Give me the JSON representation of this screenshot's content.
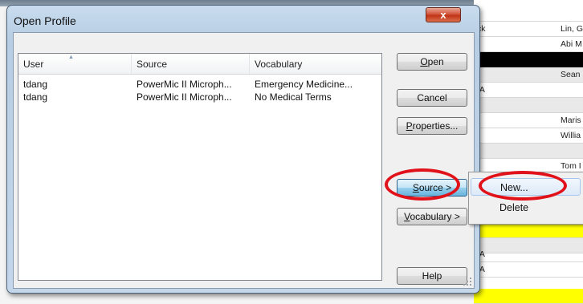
{
  "dialog": {
    "title": "Open Profile",
    "close_glyph": "x",
    "columns": [
      "User",
      "Source",
      "Vocabulary"
    ],
    "rows": [
      [
        "tdang",
        "PowerMic II Microph...",
        "Emergency Medicine..."
      ],
      [
        "tdang",
        "PowerMic II Microph...",
        "No Medical Terms"
      ]
    ],
    "buttons": {
      "open": {
        "accel": "O",
        "rest": "pen"
      },
      "cancel": "Cancel",
      "properties": {
        "accel": "P",
        "rest": "roperties..."
      },
      "source": {
        "accel": "S",
        "rest": "ource >"
      },
      "vocabulary": {
        "accel": "V",
        "rest": "ocabulary >"
      },
      "help": "Help"
    }
  },
  "context_menu": {
    "items": [
      "New...",
      "Delete"
    ]
  },
  "background": {
    "names": [
      "Lin, G",
      "Abi M",
      "Sean",
      "Maris",
      "Willia",
      "Tom I"
    ],
    "left_fragments": [
      "ck",
      "/A",
      "/A",
      "/A"
    ]
  },
  "colors": {
    "highlight_ring": "#e1111a",
    "close_button": "#c23418",
    "active_button": "#98d1ef",
    "yellow_row": "#ffff00"
  },
  "icons": [
    "close-icon",
    "sort-ascending-icon",
    "resize-grip-icon"
  ]
}
